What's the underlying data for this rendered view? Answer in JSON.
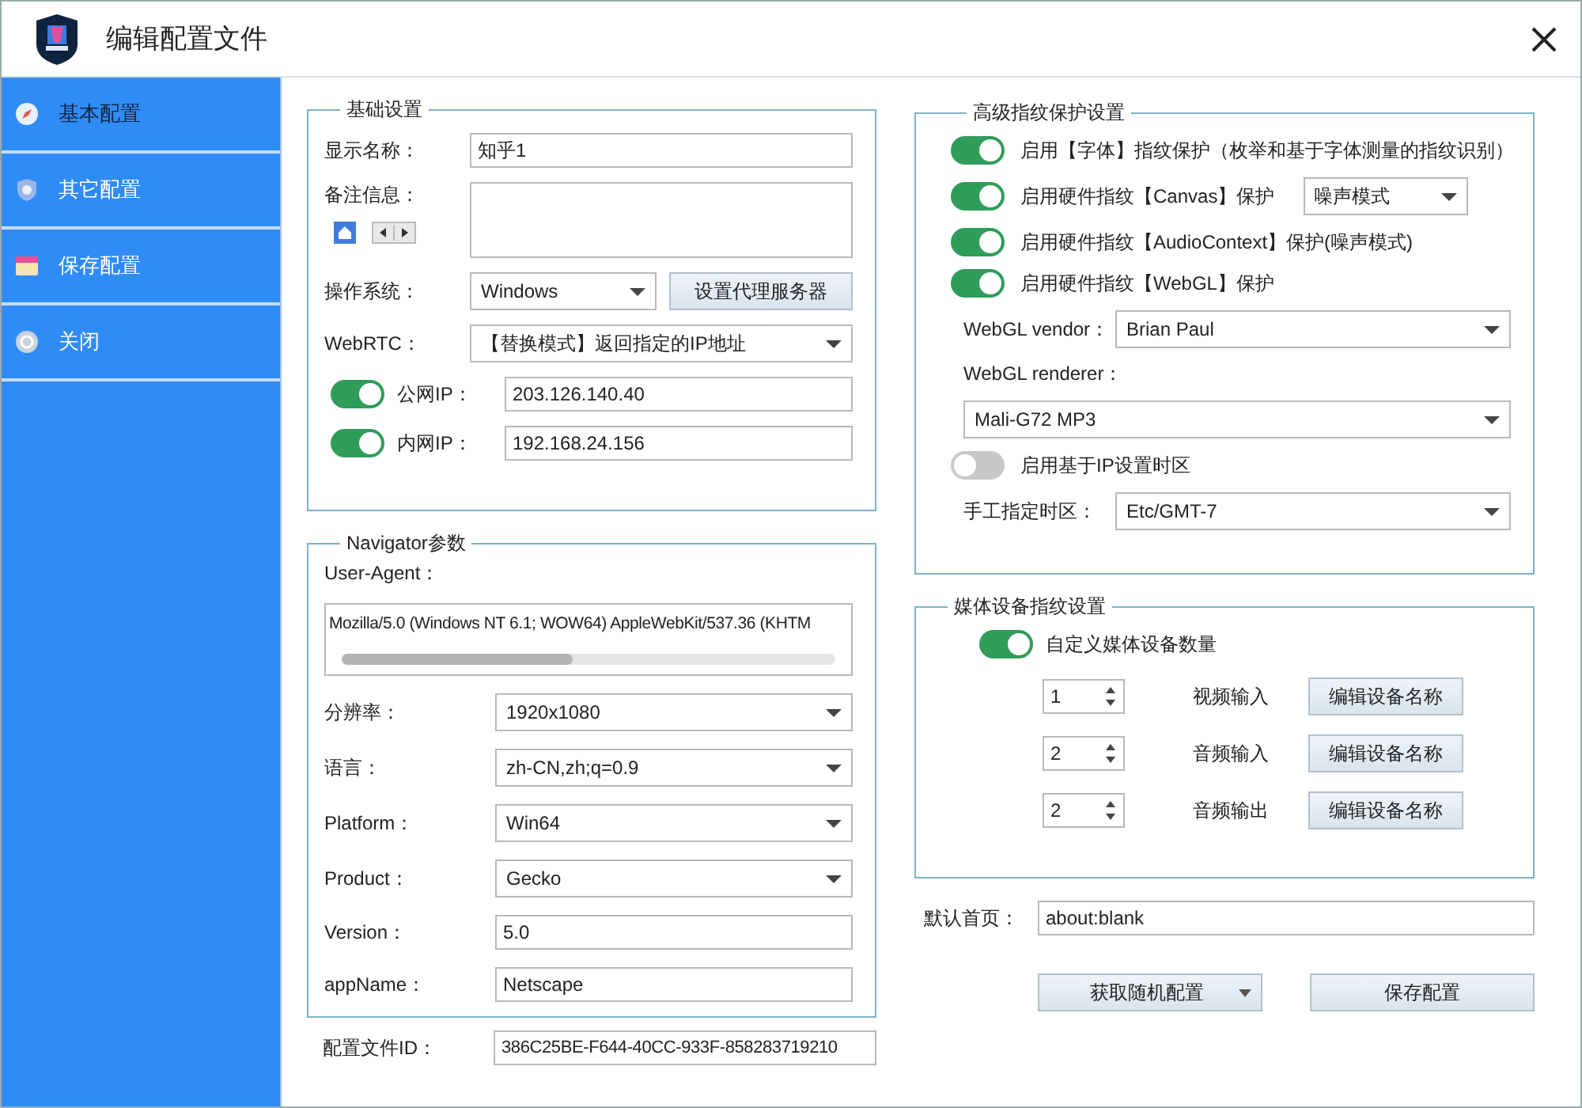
{
  "window": {
    "title": "编辑配置文件"
  },
  "sidebar": {
    "items": [
      {
        "label": "基本配置",
        "kind": "compass",
        "selected": true
      },
      {
        "label": "其它配置",
        "kind": "shield",
        "selected": false
      },
      {
        "label": "保存配置",
        "kind": "folder",
        "selected": false
      },
      {
        "label": "关闭",
        "kind": "power",
        "selected": false
      }
    ]
  },
  "basic": {
    "title": "基础设置",
    "display_name": {
      "label": "显示名称：",
      "value": "知乎1"
    },
    "note": {
      "label": "备注信息："
    },
    "os": {
      "label": "操作系统：",
      "value": "Windows"
    },
    "proxy_button": "设置代理服务器",
    "webrtc": {
      "label": "WebRTC：",
      "value": "【替换模式】返回指定的IP地址"
    },
    "ips": [
      {
        "label": "公网IP：",
        "on": true,
        "value": "203.126.140.40"
      },
      {
        "label": "内网IP：",
        "on": true,
        "value": "192.168.24.156"
      }
    ]
  },
  "navigator": {
    "title": "Navigator参数",
    "user_agent": {
      "label": "User-Agent：",
      "value": "Mozilla/5.0 (Windows NT 6.1; WOW64) AppleWebKit/537.36 (KHTM"
    },
    "fields": [
      {
        "label": "分辨率：",
        "value": "1920x1080",
        "kind": "select"
      },
      {
        "label": "语言：",
        "value": "zh-CN,zh;q=0.9",
        "kind": "select"
      },
      {
        "label": "Platform：",
        "value": "Win64",
        "kind": "select"
      },
      {
        "label": "Product：",
        "value": "Gecko",
        "kind": "select"
      },
      {
        "label": "Version：",
        "value": "5.0",
        "kind": "input"
      },
      {
        "label": "appName：",
        "value": "Netscape",
        "kind": "input"
      }
    ]
  },
  "profile_id": {
    "label": "配置文件ID：",
    "value": "386C25BE-F644-40CC-933F-858283719210"
  },
  "advanced": {
    "title": "高级指纹保护设置",
    "toggles": [
      {
        "label": "启用【字体】指纹保护（枚举和基于字体测量的指纹识别）",
        "on": true,
        "kind": "plain"
      },
      {
        "label": "启用硬件指纹【Canvas】保护",
        "on": true,
        "kind": "select",
        "value": "噪声模式"
      },
      {
        "label": "启用硬件指纹【AudioContext】保护(噪声模式)",
        "on": true,
        "kind": "plain"
      },
      {
        "label": "启用硬件指纹【WebGL】保护",
        "on": true,
        "kind": "plain"
      }
    ],
    "vendor": {
      "label": "WebGL vendor：",
      "value": "Brian Paul"
    },
    "renderer": {
      "label": "WebGL renderer：",
      "value": "Mali-G72 MP3"
    },
    "ip_timezone": {
      "label": "启用基于IP设置时区",
      "on": false
    },
    "timezone": {
      "label": "手工指定时区：",
      "value": "Etc/GMT-7"
    }
  },
  "media": {
    "title": "媒体设备指纹设置",
    "custom": {
      "label": "自定义媒体设备数量",
      "on": true
    },
    "devices": [
      {
        "count": "1",
        "label": "视频输入",
        "button": "编辑设备名称"
      },
      {
        "count": "2",
        "label": "音频输入",
        "button": "编辑设备名称"
      },
      {
        "count": "2",
        "label": "音频输出",
        "button": "编辑设备名称"
      }
    ]
  },
  "homepage": {
    "label": "默认首页：",
    "value": "about:blank"
  },
  "buttons": {
    "random": "获取随机配置",
    "save": "保存配置"
  }
}
